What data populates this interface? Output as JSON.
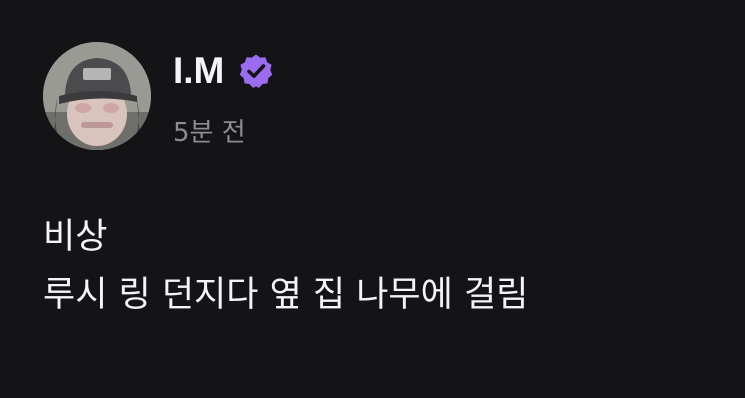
{
  "post": {
    "author": {
      "name": "I.M",
      "verified": true,
      "verified_icon": "verified-badge-icon",
      "verified_color": "#9b6cf0"
    },
    "timestamp": "5분 전",
    "body_lines": [
      "비상",
      "루시 링 던지다 옆 집 나무에 걸림"
    ]
  },
  "colors": {
    "background": "#141417",
    "text": "#f4f4f6",
    "muted_text": "#8c8c92",
    "accent": "#9b6cf0"
  }
}
